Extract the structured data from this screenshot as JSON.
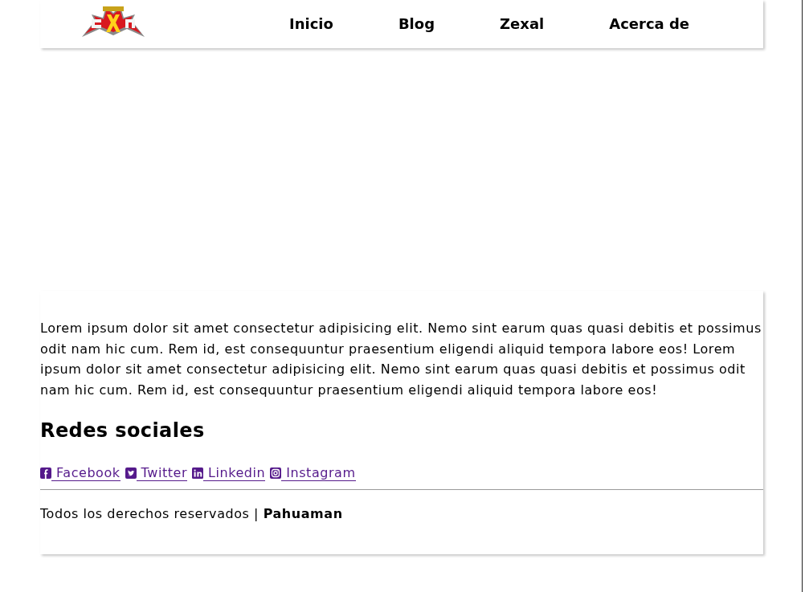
{
  "header": {
    "nav": [
      {
        "label": "Inicio"
      },
      {
        "label": "Blog"
      },
      {
        "label": "Zexal"
      },
      {
        "label": "Acerca de"
      }
    ]
  },
  "content": {
    "paragraph": "Lorem ipsum dolor sit amet consectetur adipisicing elit. Nemo sint earum quas quasi debitis et possimus odit nam hic cum. Rem id, est consequuntur praesentium eligendi aliquid tempora labore eos! Lorem ipsum dolor sit amet consectetur adipisicing elit. Nemo sint earum quas quasi debitis et possimus odit nam hic cum. Rem id, est consequuntur praesentium eligendi aliquid tempora labore eos!",
    "heading": "Redes sociales",
    "social_links": [
      {
        "kind": "facebook",
        "label": "Facebook"
      },
      {
        "kind": "twitter",
        "label": "Twitter"
      },
      {
        "kind": "linkedin",
        "label": "Linkedin"
      },
      {
        "kind": "instagram",
        "label": "Instagram"
      }
    ]
  },
  "footer": {
    "text": "Todos los derechos reservados | **Pahuaman**"
  }
}
